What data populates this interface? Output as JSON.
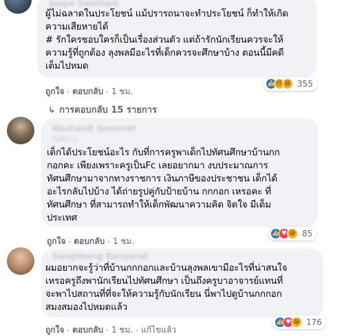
{
  "comments": [
    {
      "author": "Jaspe Sontham",
      "text": "ผู้ไม่ฉลาดในประโยชน์ แม้ปรารถนาจะทำประโยชน์ ก็ทำให้เกิด\nความเสียหายได้\n# รักใครชอบใครก็เป็นเรื่องส่วนตัว แต่ถ้ารักนักเรียนควรจะให้\nความรู้ที่ถูกต้อง ลุงพลมีอะไรที่เด็กควรจะศึกษาบ้าง ตอนนี้มีคดี\nเต็มไปหมด",
      "like_label": "ถูกใจ",
      "reply_label": "ตอบกลับ",
      "time": "1 ชม.",
      "reaction_count": "355",
      "reaction_icons": [
        "like-icon",
        "sad-icon",
        "haha-icon"
      ],
      "replies_label": "การตอบกลับ 15 รายการ"
    },
    {
      "author": "Nachanit Soomrat",
      "author_sub": "ใจดีมาก",
      "text": "เด็กได้ประโยชน์อะไร กับที่การครูพาเด็กไปทัศนศึกษาบ้านกก\nกอกคะ เพียงเพราะครูเป็นFc เลยอยากมา งบประมาณการ\nทัศนศึกษามาจากทางราชการ เงินภาษีของประชาชน เด็กได้\nอะไรกลับไปบ้าง ได้ถ่ายรูปคู่กับป้ายบ้าน กกกอก เหรอคะ ที่\nทัศนศึกษา ที่สามารถทำให้เด็กพัฒนาความคิด จิตใจ มีเต็ม\nประเทศ",
      "like_label": "ถูกใจ",
      "reply_label": "ตอบกลับ",
      "time": "1 ชม.",
      "reaction_count": "85",
      "reaction_icons": [
        "like-icon",
        "love-icon",
        "haha-icon"
      ]
    },
    {
      "author": "Sangthong Kanyarat",
      "text": "ผมอยากจะรู้ว่าที่บ้านกกกอกและบ้านลุงพลเขามีอะไรที่น่าสนใจ\nเหรอครูถึงพานักเรียนไปทัศนศึกษา เป็นถึงครูบาอาจารย์แทนที่\nจะพาไปสถานที่ที่จะให้ความรู้กับนักเรียน นี่พาไปดูบ้านกกกอก\nสมงสมองไปหมดแล้ว",
      "like_label": "ถูกใจ",
      "reply_label": "ตอบกลับ",
      "time": "1 ชม.",
      "edited": "แก้ไขแล้ว",
      "reaction_count": "176",
      "reaction_icons": [
        "like-icon",
        "love-icon",
        "haha-icon"
      ]
    }
  ],
  "colors": {
    "bubble": "#f0f2f5",
    "meta_text": "#65676b",
    "like_blue": "#1877f2",
    "love_red": "#f33e58",
    "emoji_yellow": "#f7b125"
  }
}
